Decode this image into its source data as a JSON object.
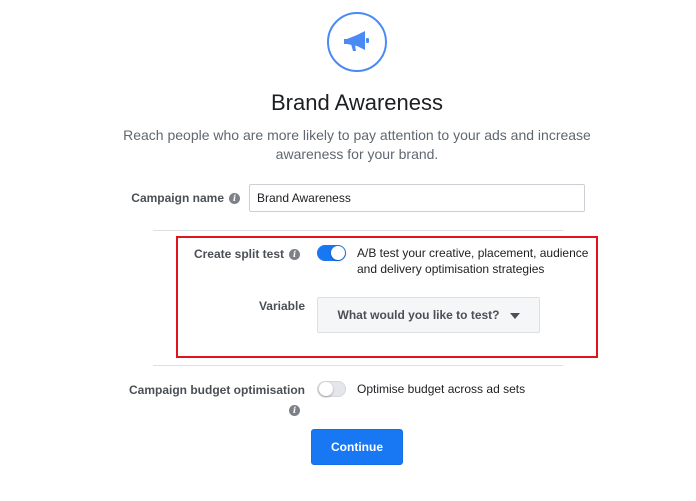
{
  "objective": {
    "icon": "megaphone-icon",
    "title": "Brand Awareness",
    "description": "Reach people who are more likely to pay attention to your ads and increase awareness for your brand."
  },
  "campaign_name": {
    "label": "Campaign name",
    "value": "Brand Awareness"
  },
  "split_test": {
    "label": "Create split test",
    "enabled": true,
    "description_line1": "A/B test your creative, placement, audience",
    "description_line2": "and delivery optimisation strategies",
    "variable_label": "Variable",
    "variable_placeholder": "What would you like to test?"
  },
  "budget_optimisation": {
    "label": "Campaign budget optimisation",
    "enabled": false,
    "description": "Optimise budget across ad sets"
  },
  "continue_label": "Continue",
  "colors": {
    "accent": "#1877f2",
    "highlight": "#e1131d",
    "icon_ring": "#4a8af4"
  }
}
